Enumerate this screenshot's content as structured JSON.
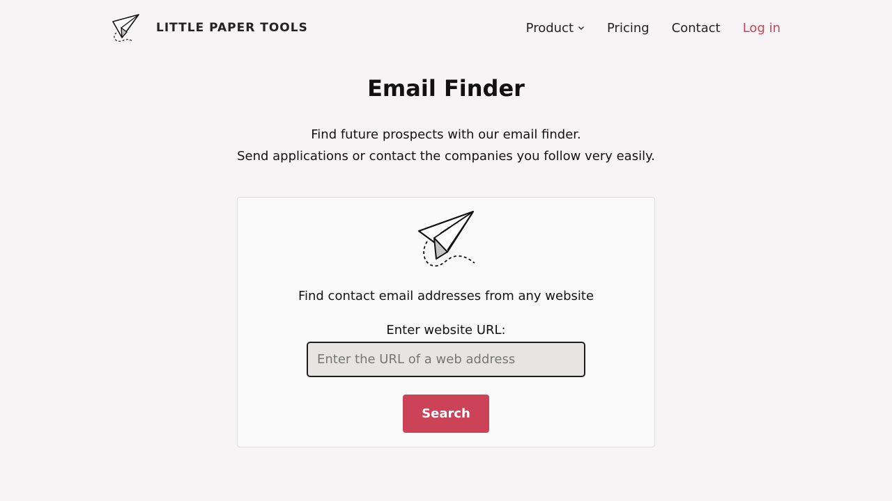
{
  "header": {
    "brand_name": "LITTLE PAPER TOOLS",
    "logo_icon": "paper-plane-icon",
    "nav": {
      "product": "Product",
      "pricing": "Pricing",
      "contact": "Contact",
      "login": "Log in"
    }
  },
  "main": {
    "title": "Email Finder",
    "intro_line_1": "Find future prospects with our email finder.",
    "intro_line_2": "Send applications or contact the companies you follow very easily."
  },
  "card": {
    "illustration_icon": "paper-plane-icon",
    "caption": "Find contact email addresses from any website",
    "field_label": "Enter website URL:",
    "url_value": "",
    "url_placeholder": "Enter the URL of a web address",
    "search_label": "Search"
  },
  "colors": {
    "background": "#f6f4f5",
    "accent": "#cc4358",
    "login_link": "#c9435a",
    "input_background": "#e8e4e3",
    "card_background": "#f9f9f9"
  }
}
